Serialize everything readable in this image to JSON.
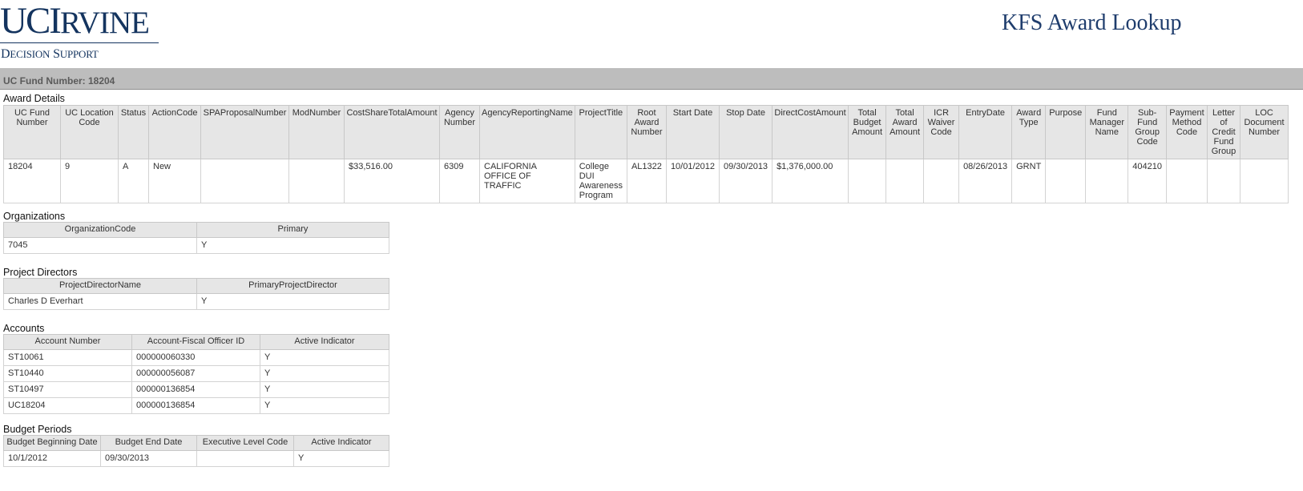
{
  "header": {
    "logo_uc": "UCI",
    "logo_rest": "RVINE",
    "logo_ds_d": "D",
    "logo_ds_ecision": "ECISION",
    "logo_ds_s": "S",
    "logo_ds_upport": "UPPORT",
    "title": "KFS Award Lookup"
  },
  "fund_bar": {
    "label": "UC Fund Number: 18204"
  },
  "award_details": {
    "title": "Award Details",
    "columns": [
      "UC Fund Number",
      "UC Location Code",
      "Status",
      "ActionCode",
      "SPAProposalNumber",
      "ModNumber",
      "CostShareTotalAmount",
      "Agency Number",
      "AgencyReportingName",
      "ProjectTitle",
      "Root Award Number",
      "Start Date",
      "Stop Date",
      "DirectCostAmount",
      "Total Budget Amount",
      "Total Award Amount",
      "ICR Waiver Code",
      "EntryDate",
      "Award Type",
      "Purpose",
      "Fund Manager Name",
      "Sub-Fund Group Code",
      "Payment Method Code",
      "Letter of Credit Fund Group",
      "LOC Document Number"
    ],
    "row": [
      "18204",
      "9",
      "A",
      "New",
      "",
      "",
      "$33,516.00",
      "6309",
      "CALIFORNIA OFFICE OF TRAFFIC",
      "College DUI Awareness Program",
      "AL1322",
      "10/01/2012",
      "09/30/2013",
      "$1,376,000.00",
      "",
      "",
      "",
      "08/26/2013",
      "GRNT",
      "",
      "",
      "404210",
      "",
      "",
      ""
    ]
  },
  "organizations": {
    "title": "Organizations",
    "columns": [
      "OrganizationCode",
      "Primary"
    ],
    "rows": [
      [
        "7045",
        "Y"
      ]
    ]
  },
  "project_directors": {
    "title": "Project Directors",
    "columns": [
      "ProjectDirectorName",
      "PrimaryProjectDirector"
    ],
    "rows": [
      [
        "Charles D Everhart",
        "Y"
      ]
    ]
  },
  "accounts": {
    "title": "Accounts",
    "columns": [
      "Account Number",
      "Account-Fiscal Officer ID",
      "Active Indicator"
    ],
    "rows": [
      [
        "ST10061",
        "000000060330",
        "Y"
      ],
      [
        "ST10440",
        "000000056087",
        "Y"
      ],
      [
        "ST10497",
        "000000136854",
        "Y"
      ],
      [
        "UC18204",
        "000000136854",
        "Y"
      ]
    ]
  },
  "budget_periods": {
    "title": "Budget Periods",
    "columns": [
      "Budget Beginning Date",
      "Budget End Date",
      "Executive Level Code",
      "Active Indicator"
    ],
    "rows": [
      [
        "10/1/2012",
        "09/30/2013",
        "",
        "Y"
      ]
    ]
  }
}
